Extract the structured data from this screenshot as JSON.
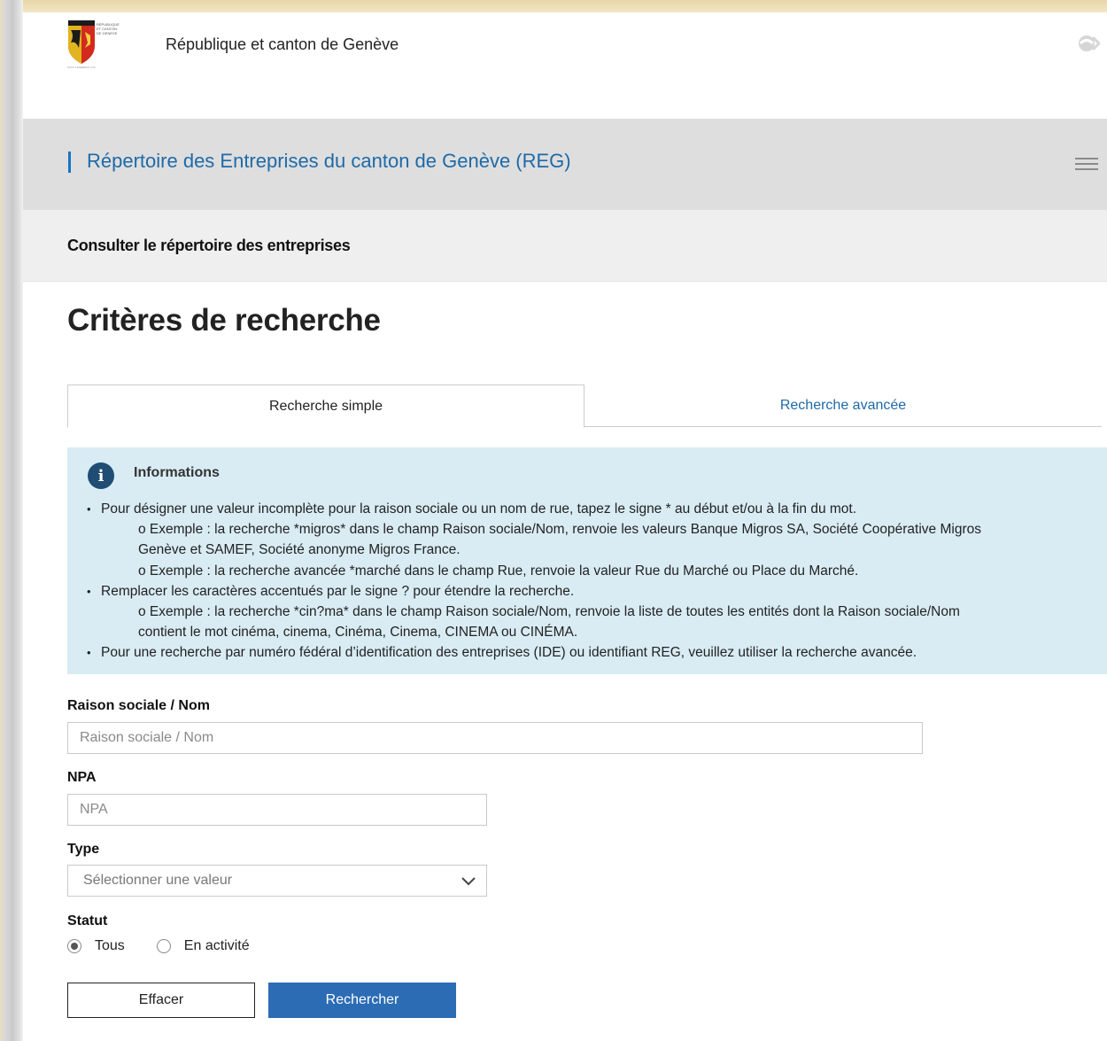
{
  "header": {
    "brand_name": "République et canton de Genève",
    "logo_text": "RÉPUBLIQUE ET CANTON DE GENEVE",
    "service_title": "Répertoire des Entreprises du canton de Genève (REG)",
    "section_title": "Consulter le répertoire des entreprises"
  },
  "main": {
    "title": "Critères de recherche",
    "tabs": [
      {
        "label": "Recherche simple",
        "active": true
      },
      {
        "label": "Recherche avancée",
        "active": false
      }
    ],
    "info": {
      "title": "Informations",
      "lines": [
        "Pour désigner une valeur incomplète pour la raison sociale ou un nom de rue, tapez le signe * au début et/ou à la fin du mot.",
        "o Exemple : la recherche *migros* dans le champ Raison sociale/Nom, renvoie les valeurs Banque Migros SA, Société Coopérative Migros",
        "Genève et SAMEF, Société anonyme Migros France.",
        "o Exemple : la recherche avancée *marché dans le champ Rue, renvoie la valeur Rue du Marché ou Place du Marché.",
        "Remplacer les caractères accentués par le signe ? pour étendre la recherche.",
        "o Exemple : la recherche *cin?ma* dans le champ Raison sociale/Nom, renvoie la liste de toutes les entités dont la Raison sociale/Nom",
        "contient le mot cinéma, cinema, Cinéma, Cinema, CINEMA ou CINÉMA.",
        "Pour une recherche par numéro fédéral d’identification des entreprises (IDE) ou identifiant REG, veuillez utiliser la recherche avancée."
      ]
    },
    "form": {
      "name_label": "Raison sociale / Nom",
      "name_placeholder": "Raison sociale / Nom",
      "npa_label": "NPA",
      "npa_placeholder": "NPA",
      "type_label": "Type",
      "type_value": "Sélectionner une valeur",
      "status_label": "Statut",
      "status_options": [
        {
          "label": "Tous",
          "selected": true
        },
        {
          "label": "En activité",
          "selected": false
        }
      ],
      "clear_label": "Effacer",
      "search_label": "Rechercher"
    }
  },
  "colors": {
    "accent": "#2b6cb4",
    "link": "#1e6aa8",
    "info_bg": "#d9ecf4",
    "service_bg": "#dedede"
  },
  "icons": [
    "geneva-coat-of-arms-logo",
    "eye-icon",
    "menu-icon",
    "info-icon",
    "chevron-down-icon"
  ]
}
